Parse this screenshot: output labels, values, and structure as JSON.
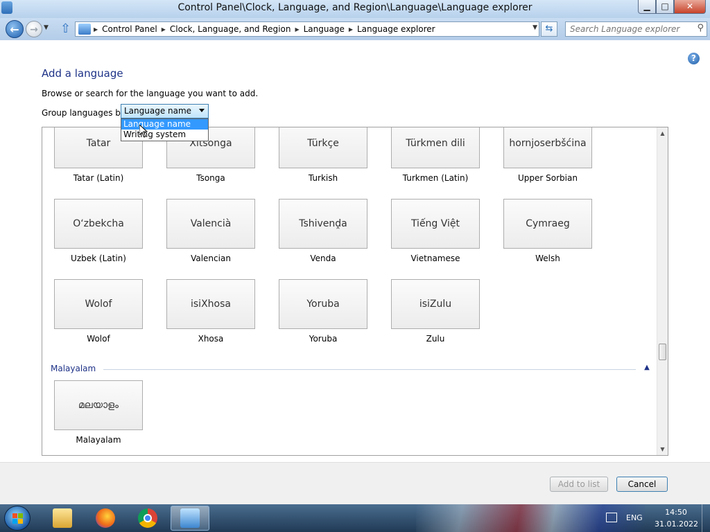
{
  "window": {
    "title": "Control Panel\\Clock, Language, and Region\\Language\\Language explorer",
    "minimize_glyph": "▁",
    "maximize_glyph": "□",
    "close_glyph": "✕"
  },
  "address": {
    "breadcrumbs": [
      "Control Panel",
      "Clock, Language, and Region",
      "Language",
      "Language explorer"
    ],
    "search_placeholder": "Search Language explorer"
  },
  "page": {
    "title": "Add a language",
    "instructions": "Browse or search for the language you want to add.",
    "group_by_label": "Group languages by:",
    "group_by_selected": "Language name",
    "group_by_options": [
      "Language name",
      "Writing system"
    ],
    "help_glyph": "?"
  },
  "language_rows": [
    [
      {
        "native": "Tatar",
        "name": "Tatar (Latin)"
      },
      {
        "native": "Xitsonga",
        "name": "Tsonga"
      },
      {
        "native": "Türkçe",
        "name": "Turkish"
      },
      {
        "native": "Türkmen dili",
        "name": "Turkmen (Latin)"
      },
      {
        "native": "hornjoserbšćina",
        "name": "Upper Sorbian"
      }
    ],
    [
      {
        "native": "O‘zbekcha",
        "name": "Uzbek (Latin)"
      },
      {
        "native": "Valencià",
        "name": "Valencian"
      },
      {
        "native": "Tshivenḓa",
        "name": "Venda"
      },
      {
        "native": "Tiếng Việt",
        "name": "Vietnamese"
      },
      {
        "native": "Cymraeg",
        "name": "Welsh"
      }
    ],
    [
      {
        "native": "Wolof",
        "name": "Wolof"
      },
      {
        "native": "isiXhosa",
        "name": "Xhosa"
      },
      {
        "native": "Yoruba",
        "name": "Yoruba"
      },
      {
        "native": "isiZulu",
        "name": "Zulu"
      }
    ]
  ],
  "malayalam_group": {
    "header": "Malayalam",
    "items": [
      {
        "native": "മലയാളം",
        "name": "Malayalam"
      }
    ]
  },
  "buttons": {
    "add_to_list": "Add to list",
    "cancel": "Cancel"
  },
  "taskbar": {
    "apps": [
      "windows-explorer",
      "firefox",
      "chrome",
      "control-panel"
    ],
    "language": "ENG",
    "time": "14:50",
    "date": "31.01.2022"
  },
  "colors": {
    "title_blue": "#1e3287",
    "selection_blue": "#3399ff"
  }
}
